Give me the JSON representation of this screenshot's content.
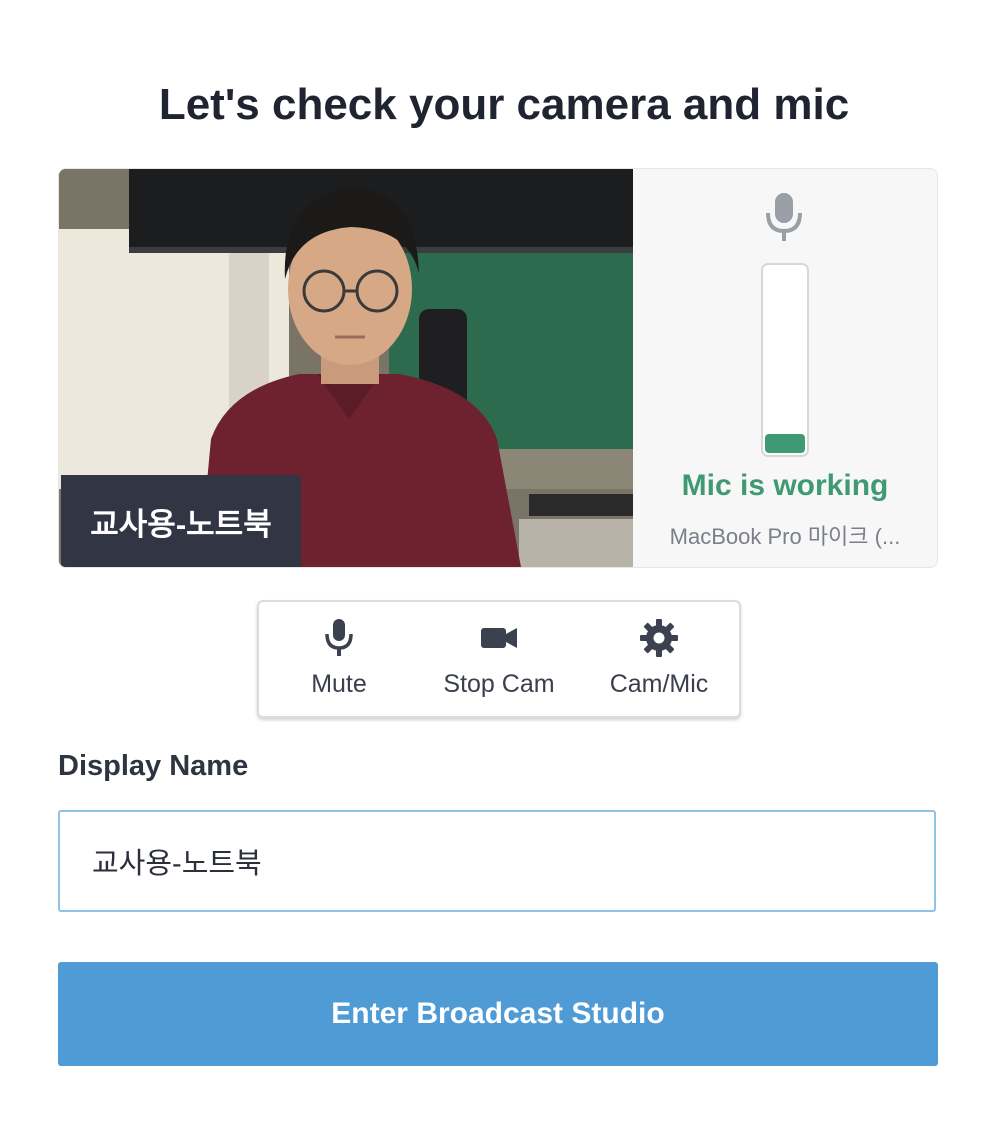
{
  "page": {
    "title": "Let's check your camera and mic"
  },
  "preview": {
    "name_tag": "교사용-노트북",
    "video_alt": "camera-preview"
  },
  "mic": {
    "icon": "microphone-icon",
    "level_fraction": 0.1,
    "status": "Mic is working",
    "status_color": "#3f9a73",
    "device": "MacBook Pro 마이크 (..."
  },
  "controls": [
    {
      "label": "Mute",
      "icon": "microphone-icon"
    },
    {
      "label": "Stop Cam",
      "icon": "video-camera-icon"
    },
    {
      "label": "Cam/Mic",
      "icon": "gear-icon"
    }
  ],
  "display_name": {
    "label": "Display Name",
    "value": "교사용-노트북"
  },
  "enter_button": {
    "label": "Enter Broadcast Studio",
    "color": "#4f9bd6"
  }
}
